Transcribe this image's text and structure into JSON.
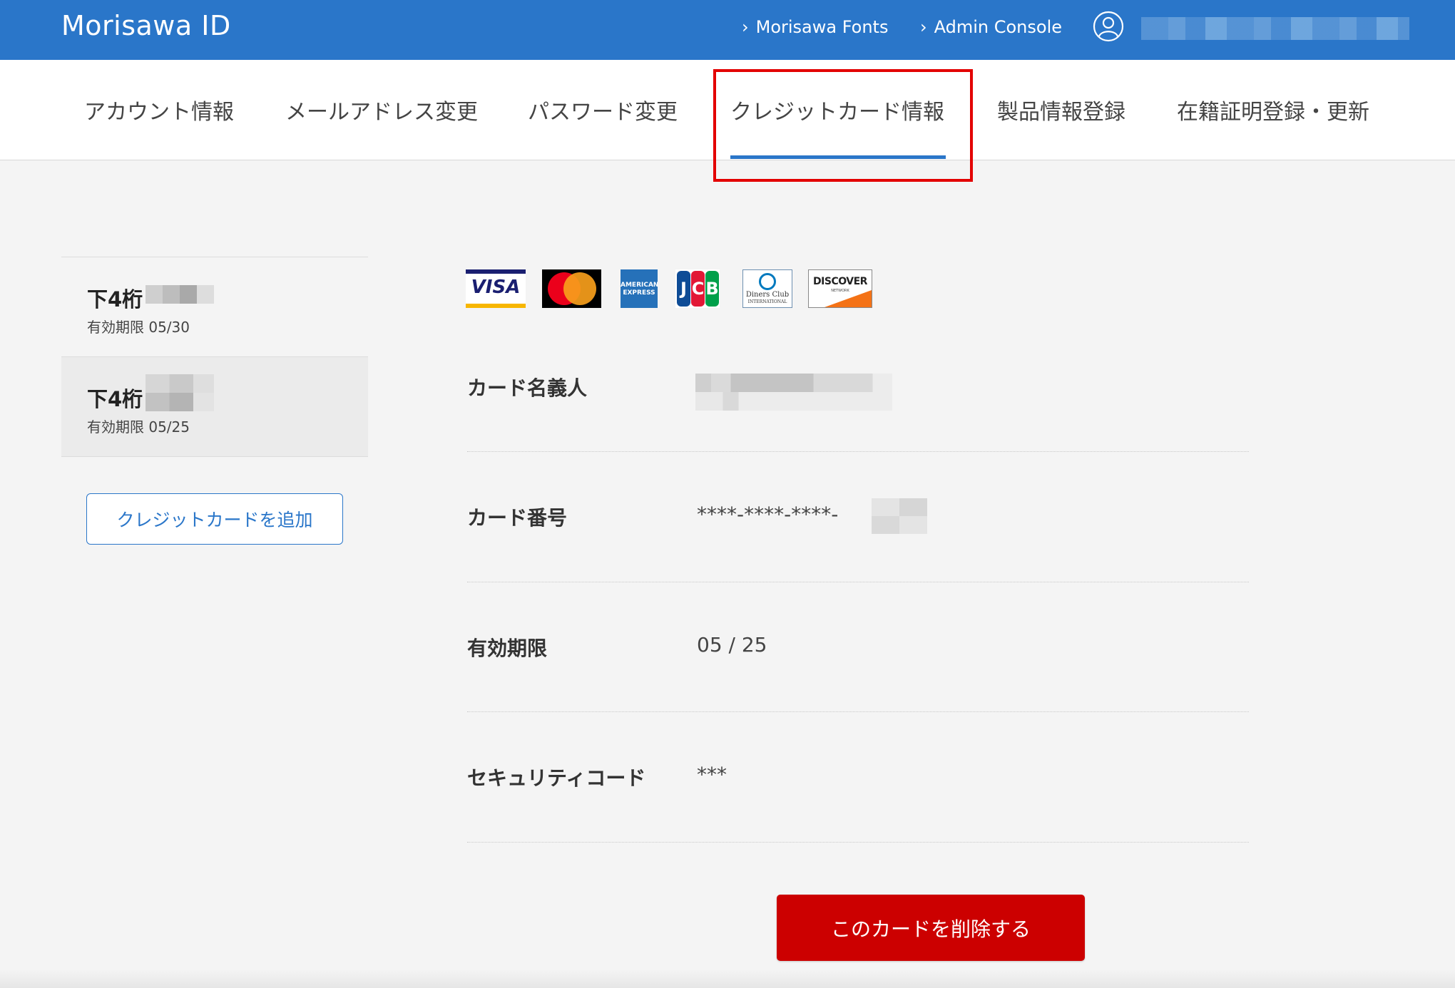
{
  "header": {
    "brand": "Morisawa ID",
    "links": [
      {
        "label": "Morisawa Fonts"
      },
      {
        "label": "Admin Console"
      }
    ]
  },
  "tabs": [
    {
      "label": "アカウント情報"
    },
    {
      "label": "メールアドレス変更"
    },
    {
      "label": "パスワード変更"
    },
    {
      "label": "クレジットカード情報",
      "active": true
    },
    {
      "label": "製品情報登録"
    },
    {
      "label": "在籍証明登録・更新"
    }
  ],
  "cards": [
    {
      "label": "下4桁",
      "expiry": "有効期限 05/30"
    },
    {
      "label": "下4桁",
      "expiry": "有効期限 05/25",
      "selected": true
    }
  ],
  "add_card_label": "クレジットカードを追加",
  "card_brands": [
    "VISA",
    "Mastercard",
    "AMERICAN EXPRESS",
    "JCB",
    "Diners Club INTERNATIONAL",
    "DISCOVER NETWORK"
  ],
  "brand_logo_text": {
    "visa": "VISA",
    "amex_line1": "AMERICAN",
    "amex_line2": "EXPRESS",
    "jcb": [
      "J",
      "C",
      "B"
    ],
    "diners_line1": "Diners Club",
    "diners_line2": "INTERNATIONAL",
    "discover_line1": "DISCOVER",
    "discover_line2": "NETWORK"
  },
  "details": {
    "holder_label": "カード名義人",
    "number_label": "カード番号",
    "number_value": "****-****-****-",
    "expiry_label": "有効期限",
    "expiry_value": "05 / 25",
    "cvc_label": "セキュリティコード",
    "cvc_value": "***"
  },
  "delete_label": "このカードを削除する",
  "colors": {
    "header_bg": "#2a76c9",
    "accent": "#2a76c9",
    "danger": "#cc0000",
    "highlight": "#e30000"
  },
  "icons": {
    "chevron": "chevron-right-icon",
    "user": "user-circle-icon"
  }
}
